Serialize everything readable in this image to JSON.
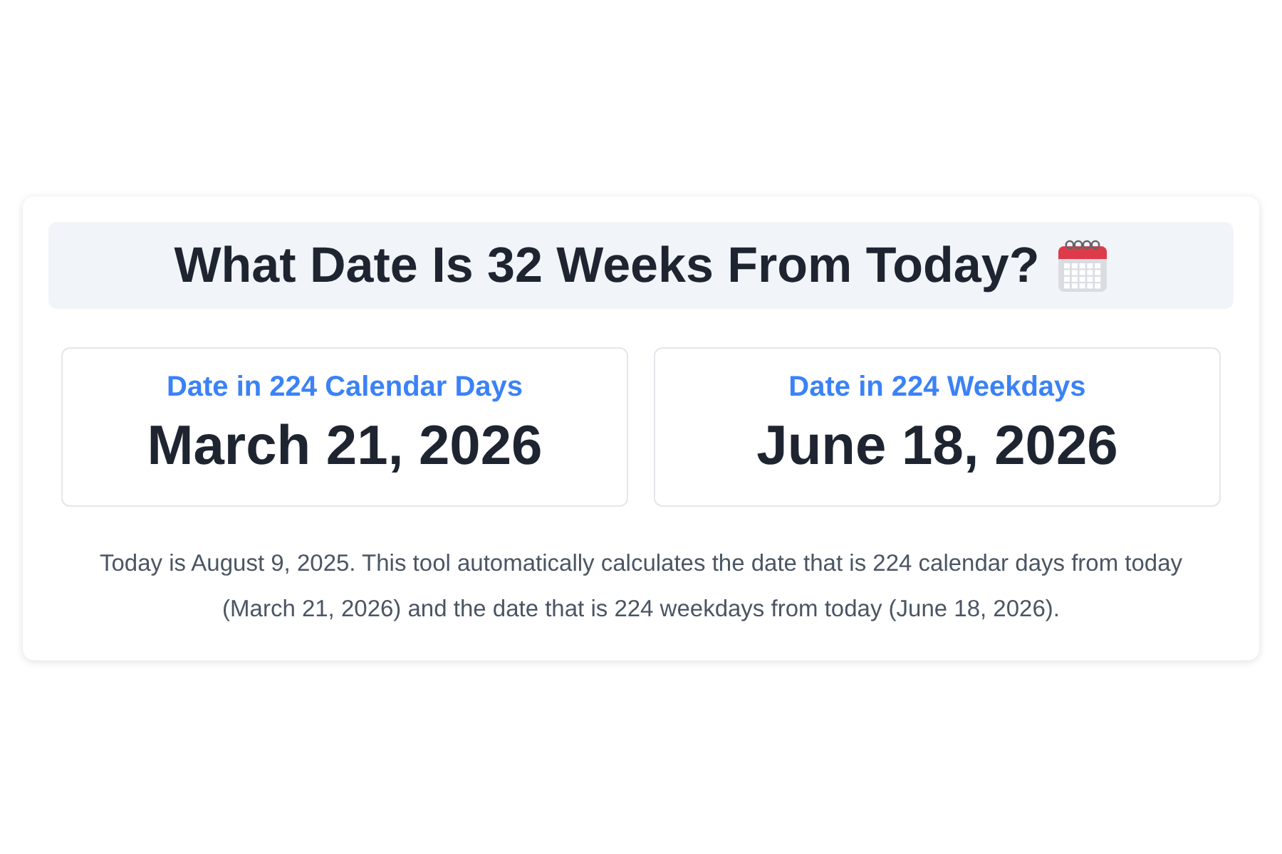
{
  "title": "What Date Is 32 Weeks From Today?",
  "results": [
    {
      "label": "Date in 224 Calendar Days",
      "date": "March 21, 2026"
    },
    {
      "label": "Date in 224 Weekdays",
      "date": "June 18, 2026"
    }
  ],
  "description": "Today is August 9, 2025. This tool automatically calculates the date that is 224 calendar days from today (March 21, 2026) and the date that is 224 weekdays from today (June 18, 2026)."
}
